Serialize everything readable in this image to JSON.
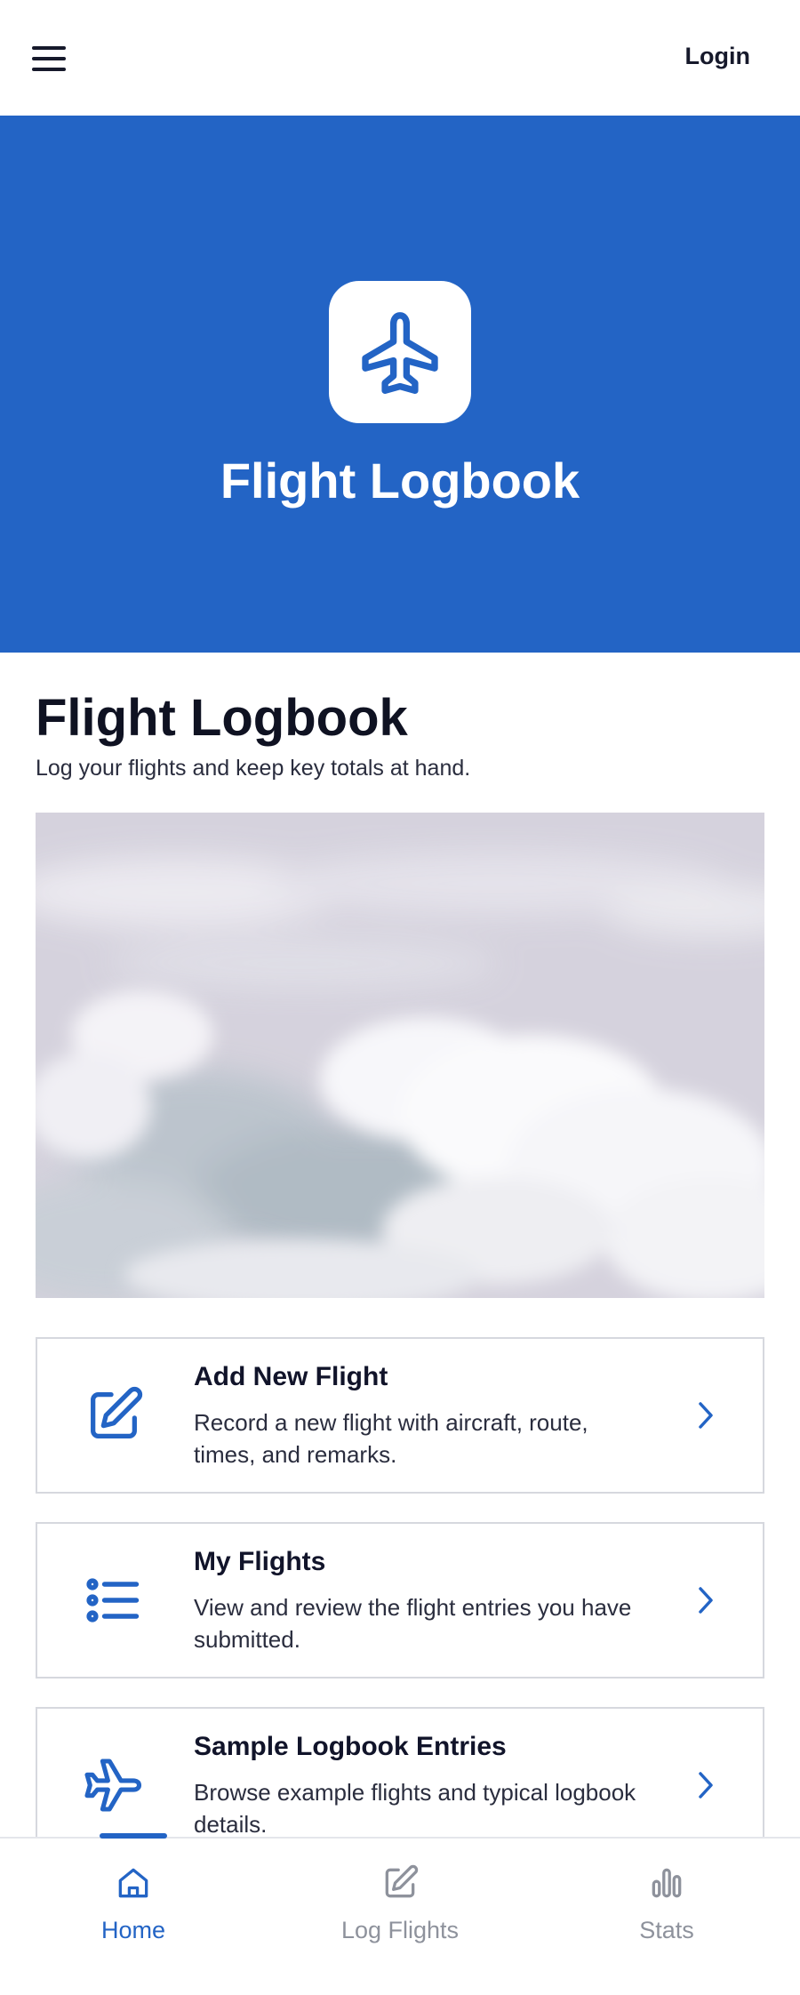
{
  "header": {
    "login_label": "Login"
  },
  "hero": {
    "title": "Flight Logbook",
    "icon": "airplane-icon"
  },
  "intro": {
    "title": "Flight Logbook",
    "subtitle": "Log your flights and keep key totals at hand."
  },
  "cards": [
    {
      "title": "Add New Flight",
      "description": "Record a new flight with aircraft, route, times, and remarks.",
      "icon": "edit-icon"
    },
    {
      "title": "My Flights",
      "description": "View and review the flight entries you have submitted.",
      "icon": "list-icon"
    },
    {
      "title": "Sample Logbook Entries",
      "description": "Browse example flights and typical logbook details.",
      "icon": "airplane-icon"
    }
  ],
  "bottom_nav": {
    "items": [
      {
        "label": "Home",
        "icon": "home-icon",
        "active": true
      },
      {
        "label": "Log Flights",
        "icon": "edit-icon",
        "active": false
      },
      {
        "label": "Stats",
        "icon": "bar-chart-icon",
        "active": false
      }
    ]
  },
  "colors": {
    "primary": "#2364c5",
    "text_dark": "#16192b",
    "nav_inactive": "#8e929c",
    "border": "#d6d8de"
  }
}
